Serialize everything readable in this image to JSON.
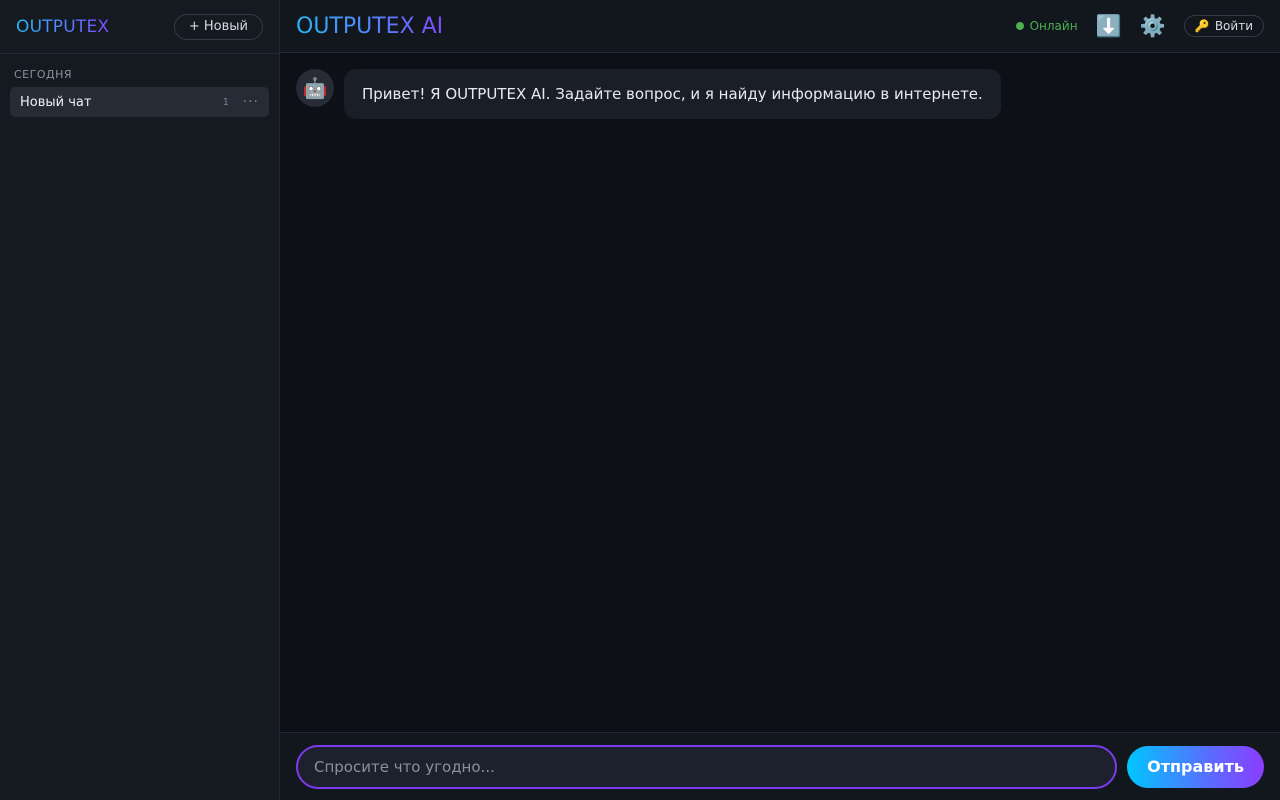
{
  "sidebar": {
    "brand": "OUTPUTEX",
    "new_button": "+ Новый",
    "section_today": "СЕГОДНЯ",
    "chats": [
      {
        "label": "Новый чат",
        "count": "1",
        "menu": "···"
      }
    ]
  },
  "header": {
    "title": "OUTPUTEX AI",
    "status": "Онлайн",
    "status_color": "#4caf50",
    "download_icon": "⬇️",
    "settings_icon": "⚙️",
    "login_icon": "🔑",
    "login_label": "Войти"
  },
  "messages": [
    {
      "role": "assistant",
      "avatar": "🤖",
      "text": "Привет! Я OUTPUTEX AI. Задайте вопрос, и я найду информацию в интернете."
    }
  ],
  "composer": {
    "placeholder": "Спросите что угодно...",
    "value": "",
    "send_label": "Отправить"
  },
  "colors": {
    "accent_start": "#29b6f6",
    "accent_end": "#7c4dff",
    "input_border": "#7c3aed"
  }
}
